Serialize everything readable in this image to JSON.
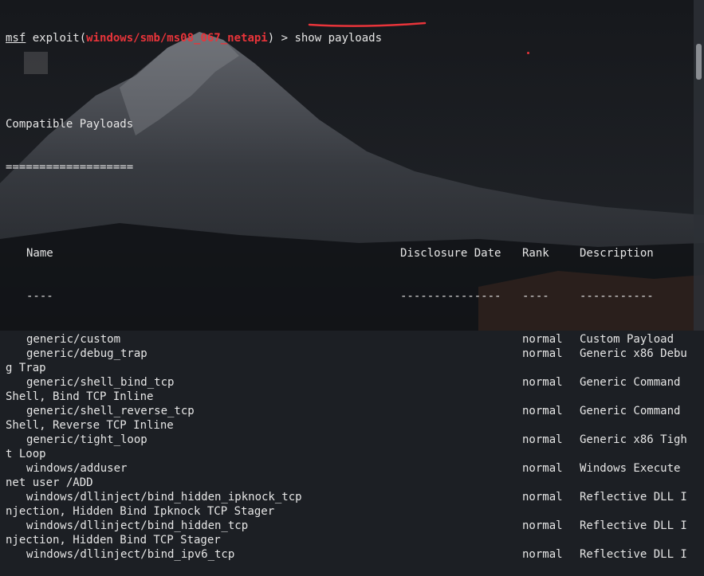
{
  "colors": {
    "accent_red": "#e8343a",
    "text": "#e6e6e6",
    "background": "#1c1f24"
  },
  "prompt": {
    "msf": "msf",
    "exploit_prefix": " exploit(",
    "module": "windows/smb/ms08_067_netapi",
    "suffix": ") > ",
    "command": "show payloads"
  },
  "heading": "Compatible Payloads",
  "heading_rule": "===================",
  "table": {
    "headers": {
      "name": "Name",
      "date": "Disclosure Date",
      "rank": "Rank",
      "desc": "Description"
    },
    "dividers": {
      "name": "----",
      "date": "---------------",
      "rank": "----",
      "desc": "-----------"
    },
    "rows": [
      {
        "name": "generic/custom",
        "rank": "normal",
        "desc": "Custom Payload",
        "wrap": ""
      },
      {
        "name": "generic/debug_trap",
        "rank": "normal",
        "desc": "Generic x86 Debu",
        "wrap": "g Trap"
      },
      {
        "name": "generic/shell_bind_tcp",
        "rank": "normal",
        "desc": "Generic Command",
        "wrap": "Shell, Bind TCP Inline"
      },
      {
        "name": "generic/shell_reverse_tcp",
        "rank": "normal",
        "desc": "Generic Command",
        "wrap": "Shell, Reverse TCP Inline"
      },
      {
        "name": "generic/tight_loop",
        "rank": "normal",
        "desc": "Generic x86 Tigh",
        "wrap": "t Loop"
      },
      {
        "name": "windows/adduser",
        "rank": "normal",
        "desc": "Windows Execute",
        "wrap": "net user /ADD"
      },
      {
        "name": "windows/dllinject/bind_hidden_ipknock_tcp",
        "rank": "normal",
        "desc": "Reflective DLL I",
        "wrap": "njection, Hidden Bind Ipknock TCP Stager"
      },
      {
        "name": "windows/dllinject/bind_hidden_tcp",
        "rank": "normal",
        "desc": "Reflective DLL I",
        "wrap": "njection, Hidden Bind TCP Stager"
      },
      {
        "name": "windows/dllinject/bind_ipv6_tcp",
        "rank": "normal",
        "desc": "Reflective DLL I",
        "wrap": ""
      }
    ]
  }
}
